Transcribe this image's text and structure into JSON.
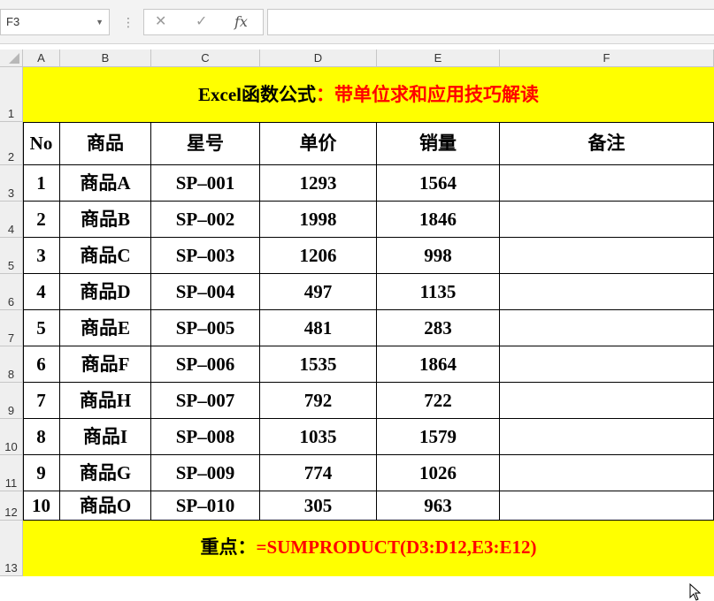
{
  "formula_bar": {
    "name_box": "F3",
    "formula": ""
  },
  "columns": [
    "A",
    "B",
    "C",
    "D",
    "E",
    "F"
  ],
  "rows": [
    "1",
    "2",
    "3",
    "4",
    "5",
    "6",
    "7",
    "8",
    "9",
    "10",
    "11",
    "12",
    "13"
  ],
  "title": {
    "black": "Excel函数公式",
    "red": "：带单位求和应用技巧解读"
  },
  "table": {
    "headers": [
      "No",
      "商品",
      "星号",
      "单价",
      "销量",
      "备注"
    ],
    "rows": [
      [
        "1",
        "商品A",
        "SP–001",
        "1293",
        "1564",
        ""
      ],
      [
        "2",
        "商品B",
        "SP–002",
        "1998",
        "1846",
        ""
      ],
      [
        "3",
        "商品C",
        "SP–003",
        "1206",
        "998",
        ""
      ],
      [
        "4",
        "商品D",
        "SP–004",
        "497",
        "1135",
        ""
      ],
      [
        "5",
        "商品E",
        "SP–005",
        "481",
        "283",
        ""
      ],
      [
        "6",
        "商品F",
        "SP–006",
        "1535",
        "1864",
        ""
      ],
      [
        "7",
        "商品H",
        "SP–007",
        "792",
        "722",
        ""
      ],
      [
        "8",
        "商品I",
        "SP–008",
        "1035",
        "1579",
        ""
      ],
      [
        "9",
        "商品G",
        "SP–009",
        "774",
        "1026",
        ""
      ],
      [
        "10",
        "商品O",
        "SP–010",
        "305",
        "963",
        ""
      ]
    ]
  },
  "footer": {
    "black": "重点：",
    "red": "=SUMPRODUCT(D3:D12,E3:E12)"
  },
  "colors": {
    "highlight": "#ffff00",
    "accent_text": "#ff0000"
  }
}
